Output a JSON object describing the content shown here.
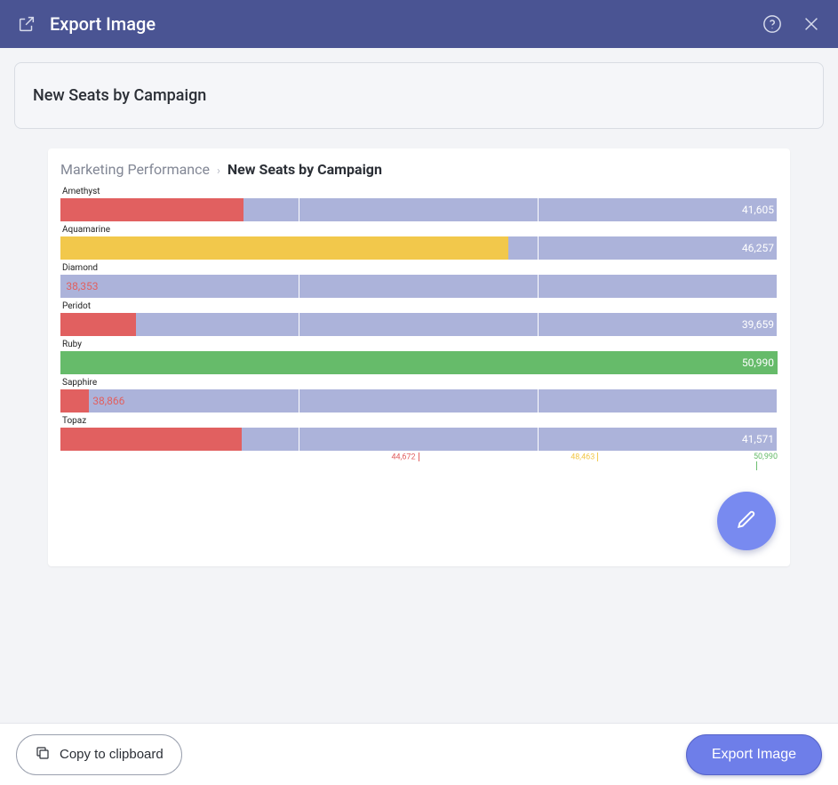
{
  "header": {
    "title": "Export Image",
    "open_icon": "open-in-new",
    "help_icon": "help",
    "close_icon": "close"
  },
  "panel": {
    "title": "New Seats by Campaign"
  },
  "breadcrumb": {
    "parent": "Marketing Performance",
    "separator": "›",
    "current": "New Seats by Campaign"
  },
  "chart_data": {
    "type": "bar",
    "orientation": "horizontal",
    "title": "New Seats by Campaign",
    "xlabel": "",
    "ylabel": "",
    "categories": [
      "Amethyst",
      "Aquamarine",
      "Diamond",
      "Peridot",
      "Ruby",
      "Sapphire",
      "Topaz"
    ],
    "values": [
      41605,
      46257,
      38353,
      39659,
      50990,
      38866,
      41571
    ],
    "bar_colors": [
      "#e16060",
      "#f2c84b",
      "#acb3da",
      "#e16060",
      "#66bb6a",
      "#e16060",
      "#e16060"
    ],
    "label_positions": [
      "inside",
      "inside",
      "outside",
      "inside",
      "inside",
      "outside",
      "inside"
    ],
    "bar_widths_pct": [
      25.5,
      62.5,
      0.3,
      10.5,
      100,
      4,
      25.3
    ],
    "track_segments": 3,
    "x_ticks": [
      {
        "value": 44672,
        "label": "44,672",
        "color": "#e16060",
        "pos_pct": 50
      },
      {
        "value": 48463,
        "label": "48,463",
        "color": "#f2c84b",
        "pos_pct": 75
      },
      {
        "value": 50990,
        "label": "50,990",
        "color": "#66bb6a",
        "pos_pct": 100
      }
    ],
    "xlim": [
      38300,
      50990
    ]
  },
  "value_labels": [
    "41,605",
    "46,257",
    "38,353",
    "39,659",
    "50,990",
    "38,866",
    "41,571"
  ],
  "footer": {
    "copy_label": "Copy to clipboard",
    "export_label": "Export Image"
  },
  "icons": {
    "edit": "pencil",
    "copy": "copy"
  }
}
